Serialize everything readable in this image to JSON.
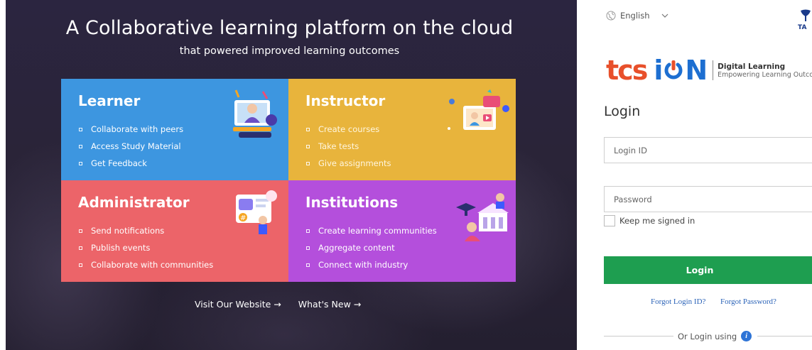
{
  "hero": {
    "title": "A Collaborative learning platform on the cloud",
    "subtitle": "that powered improved learning outcomes",
    "cards": [
      {
        "title": "Learner",
        "color": "#3d96e0",
        "items": [
          "Collaborate with peers",
          "Access Study Material",
          "Get Feedback"
        ]
      },
      {
        "title": "Instructor",
        "color": "#e8b43c",
        "items": [
          "Create courses",
          "Take tests",
          "Give assignments"
        ]
      },
      {
        "title": "Administrator",
        "color": "#ec6469",
        "items": [
          "Send notifications",
          "Publish events",
          "Collaborate with communities"
        ]
      },
      {
        "title": "Institutions",
        "color": "#b44fdc",
        "items": [
          "Create learning communities",
          "Aggregate content",
          "Connect with industry"
        ]
      }
    ],
    "links": {
      "visit_website": "Visit Our Website →",
      "whats_new": "What's New →"
    }
  },
  "panel": {
    "language": "English",
    "logo": {
      "tcs": "tcs",
      "ion_left": "i",
      "ion_right": "N",
      "tag_title": "Digital Learning",
      "tag_sub": "Empowering Learning Outcomes"
    },
    "heading": "Login",
    "login_id_placeholder": "Login ID",
    "password_placeholder": "Password",
    "remember_label": "Keep me signed in",
    "login_button": "Login",
    "forgot_login_id": "Forgot Login ID?",
    "forgot_password": "Forgot Password?",
    "or_login_using": "Or Login using",
    "accent_color": "#1e9e50",
    "link_color": "#2b63b8"
  }
}
